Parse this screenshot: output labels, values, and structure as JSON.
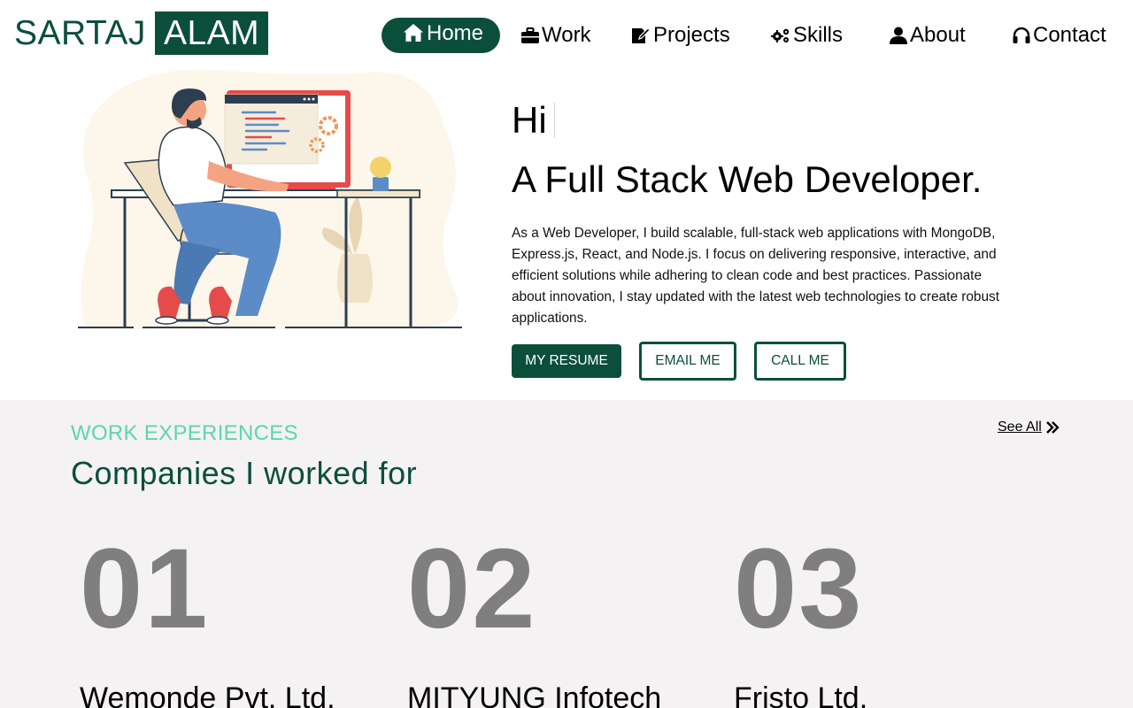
{
  "logo": {
    "first": "SARTAJ",
    "last": "ALAM"
  },
  "colors": {
    "brand": "#0b4f3a",
    "accent": "#5ed6a8",
    "section_bg": "#f4f2f2",
    "number_gray": "#7f7f7f"
  },
  "nav": {
    "items": [
      {
        "label": "Home",
        "icon": "home-icon",
        "active": true
      },
      {
        "label": "Work",
        "icon": "briefcase-icon",
        "active": false
      },
      {
        "label": "Projects",
        "icon": "edit-icon",
        "active": false
      },
      {
        "label": "Skills",
        "icon": "gears-icon",
        "active": false
      },
      {
        "label": "About",
        "icon": "user-icon",
        "active": false
      },
      {
        "label": "Contact",
        "icon": "headphones-icon",
        "active": false
      }
    ]
  },
  "hero": {
    "greeting": "Hi",
    "headline": "A Full Stack Web Developer.",
    "description": "As a Web Developer, I build scalable, full-stack web applications with MongoDB, Express.js, React, and Node.js. I focus on delivering responsive, interactive, and efficient solutions while adhering to clean code and best practices. Passionate about innovation, I stay updated with the latest web technologies to create robust applications.",
    "buttons": {
      "resume": "MY RESUME",
      "email": "EMAIL ME",
      "call": "CALL ME"
    }
  },
  "work": {
    "eyebrow": "WORK EXPERIENCES",
    "title": "Companies I worked for",
    "see_all": "See All",
    "companies": [
      {
        "number": "01",
        "name": "Wemonde Pvt. Ltd."
      },
      {
        "number": "02",
        "name": "MITYUNG Infotech"
      },
      {
        "number": "03",
        "name": "Fristo Ltd."
      }
    ]
  }
}
